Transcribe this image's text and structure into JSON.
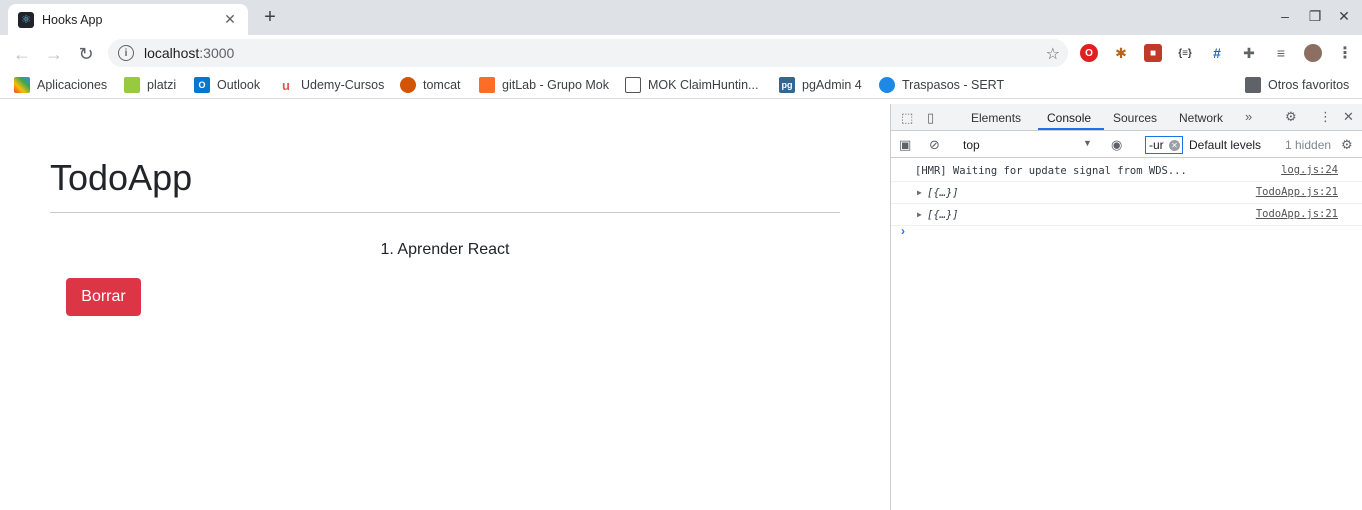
{
  "browser": {
    "tab_title": "Hooks App",
    "url_host": "localhost",
    "url_port": ":3000"
  },
  "bookmarks": [
    {
      "label": "Aplicaciones",
      "color": "#ea4335"
    },
    {
      "label": "platzi",
      "color": "#98ca3f"
    },
    {
      "label": "Outlook",
      "color": "#0078d4"
    },
    {
      "label": "Udemy-Cursos",
      "color": "#ec5252"
    },
    {
      "label": "tomcat",
      "color": "#d35400"
    },
    {
      "label": "gitLab - Grupo Mok",
      "color": "#fc6d26"
    },
    {
      "label": "MOK ClaimHuntin...",
      "color": "#555555"
    },
    {
      "label": "pgAdmin 4",
      "color": "#336791"
    },
    {
      "label": "Traspasos - SERT",
      "color": "#1e88e5"
    }
  ],
  "other_bookmarks": "Otros favoritos",
  "app": {
    "title": "TodoApp",
    "todos": [
      "1. Aprender React"
    ],
    "delete_label": "Borrar",
    "delete_color": "#dc3545"
  },
  "devtools": {
    "tabs": [
      "Elements",
      "Console",
      "Sources",
      "Network"
    ],
    "active_tab": "Console",
    "context": "top",
    "filter_value": "-ur",
    "levels": "Default levels",
    "hidden": "1 hidden",
    "logs": [
      {
        "message": "[HMR] Waiting for update signal from WDS...",
        "source": "log.js:24",
        "expandable": false
      },
      {
        "message": "[{…}]",
        "source": "TodoApp.js:21",
        "expandable": true
      },
      {
        "message": "[{…}]",
        "source": "TodoApp.js:21",
        "expandable": true
      }
    ]
  }
}
